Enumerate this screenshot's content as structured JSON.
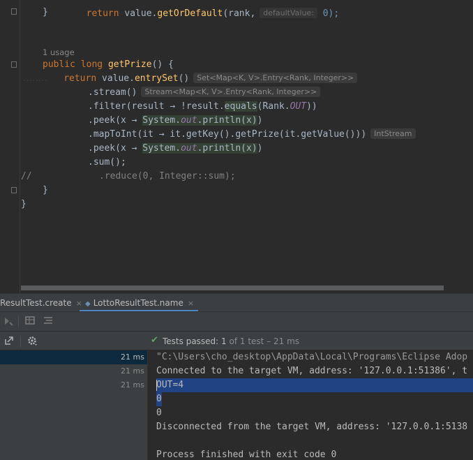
{
  "editor": {
    "lines": {
      "l1": {
        "kw": "return",
        "rest1": " value.",
        "fn": "getOrDefault",
        "rest2": "(rank,",
        "hint": "defaultValue:",
        "tail": " 0);"
      },
      "l2": {
        "brace": "}"
      },
      "usage": "1 usage",
      "l4": {
        "kw1": "public",
        "kw2": "long",
        "fn": "getPrize",
        "rest": "() {"
      },
      "l5": {
        "kw": "return",
        "a": " value.",
        "fn": "entrySet",
        "b": "()",
        "hint": "Set<Map<K, V>.Entry<Rank, Integer>>"
      },
      "l6": {
        "text": ".stream()",
        "hint": "Stream<Map<K, V>.Entry<Rank, Integer>>"
      },
      "l7": {
        "a": ".filter(result → !result.",
        "hl": "equals",
        "b": "(Rank.",
        "c": "OUT",
        "d": "))"
      },
      "l8": {
        "a": ".peek(x → ",
        "b": "System.",
        "c": "out",
        "d": ".println(x)",
        "e": ")"
      },
      "l9": {
        "a": ".mapToInt(it → it.getKey().getPrize(it.getValue()))",
        "hint": "IntStream"
      },
      "l10": {
        "a": ".peek(x → ",
        "b": "System.",
        "c": "out",
        "d": ".println(x)",
        "e": ")"
      },
      "l11": {
        "a": ".sum();"
      },
      "l12": {
        "prefix": "//",
        "a": ".reduce(0, Integer::sum);"
      },
      "l13": {
        "brace": "}"
      },
      "l14": {
        "brace": "}"
      }
    }
  },
  "tabs": [
    {
      "label": "ResultTest.create",
      "close": "×"
    },
    {
      "label": "LottoResultTest.name",
      "close": "×"
    }
  ],
  "status": {
    "prefix": "Tests passed:",
    "count": "1",
    "suffix": "of 1 test – 21 ms"
  },
  "tree": {
    "rows": [
      {
        "time": "21 ms"
      },
      {
        "time": "21 ms"
      },
      {
        "time": "21 ms"
      }
    ]
  },
  "console": {
    "lines": [
      "\"C:\\Users\\cho_desktop\\AppData\\Local\\Programs\\Eclipse Adop",
      "Connected to the target VM, address: '127.0.0.1:51386', t",
      "OUT=4",
      "0",
      "0",
      "Disconnected from the target VM, address: '127.0.0.1:5138",
      "",
      "Process finished with exit code 0"
    ]
  },
  "colors": {
    "editor_bg": "#2b2b2b",
    "keyword": "#cc7832",
    "method": "#ffc66d",
    "field": "#9876aa",
    "selection": "#214283",
    "passed_check": "#59a869",
    "tab_underline": "#4a88c7"
  },
  "icons": {
    "rerun": "rerun-icon",
    "toggle": "toggle-icon",
    "list": "list-icon",
    "export": "export-icon",
    "settings": "gear-icon",
    "check": "check-icon"
  }
}
